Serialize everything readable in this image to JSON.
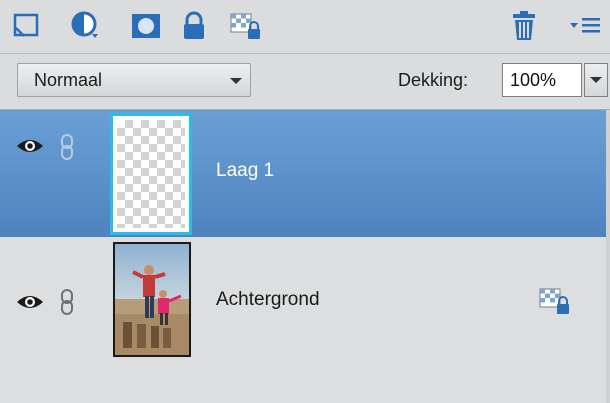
{
  "toolbar": {
    "icons": [
      "new-layer-icon",
      "adjustment-layer-icon",
      "layer-mask-icon",
      "lock-all-icon",
      "lock-transparency-icon",
      "delete-layer-icon",
      "panel-menu-icon"
    ]
  },
  "options": {
    "blend_mode": "Normaal",
    "opacity_label": "Dekking:",
    "opacity_value": "100%"
  },
  "layers": [
    {
      "name": "Laag 1",
      "selected": true,
      "visible": true,
      "thumbnail": "transparent"
    },
    {
      "name": "Achtergrond",
      "selected": false,
      "visible": true,
      "thumbnail": "photo",
      "locked": true
    }
  ],
  "colors": {
    "selected_row": "#5a8fcb",
    "selected_thumb_border": "#2bbcec",
    "panel_bg": "#dcdedf",
    "icon_blue": "#2c6db8"
  }
}
